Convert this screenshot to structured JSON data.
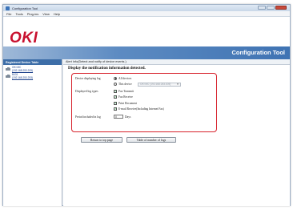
{
  "window": {
    "title": "Configuration Tool"
  },
  "menu": {
    "items": [
      "File",
      "Tools",
      "Plug-ins",
      "View",
      "Help"
    ]
  },
  "header": {
    "logo": "OKI",
    "banner_title": "Configuration Tool"
  },
  "sidebar": {
    "heading": "Registered Device Table",
    "devices": [
      {
        "name": "OKI MC",
        "address": "(192.168.253.205)"
      },
      {
        "name": "B431",
        "address": "(192.168.253.253)"
      }
    ]
  },
  "main": {
    "heading": "Alert Info(Detect and notify of device events.)",
    "section_title": "Display the notification information detected.",
    "device_label": "Device displaying log",
    "device_options": [
      {
        "label": "All devices",
        "selected": true
      },
      {
        "label": "This device",
        "selected": false
      }
    ],
    "device_select_value": "OKI MC (192.168.253.205)",
    "log_types_label": "Displayed log types",
    "log_types": [
      {
        "label": "Fax Transmit",
        "checked": true
      },
      {
        "label": "Fax Receive",
        "checked": true
      },
      {
        "label": "Print Document",
        "checked": true
      },
      {
        "label": "E-mail Receive(Including Internet Fax)",
        "checked": true
      }
    ],
    "period_label": "Period included in log",
    "period_value": "0",
    "period_unit": "Days",
    "buttons": {
      "return": "Return to top page",
      "table": "Table of number of logs"
    }
  },
  "colors": {
    "brand_red": "#c8102e",
    "banner_blue": "#3f73b3",
    "highlight_border": "#d7222c"
  }
}
